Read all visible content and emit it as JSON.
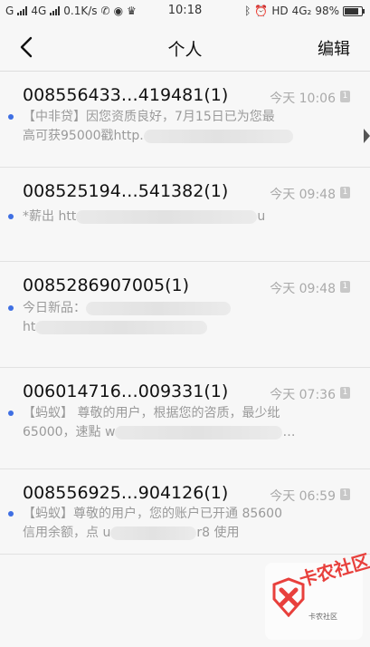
{
  "status_bar": {
    "signal_left": "G",
    "network": "4G",
    "speed": "0.1K/s",
    "time": "10:18",
    "hd": "HD",
    "network_right": "4G₂",
    "battery": "98%"
  },
  "nav": {
    "title": "个人",
    "edit_label": "编辑"
  },
  "messages": [
    {
      "sender": "008556433…419481(1)",
      "time": "今天 10:06",
      "sim": "1",
      "preview_line1": "【中非贷】因您资质良好，7月15日已为您最",
      "preview_line2": "高可获95000戳http."
    },
    {
      "sender": "008525194…541382(1)",
      "time": "今天 09:48",
      "sim": "1",
      "preview_line1": "*薪出  htt",
      "preview_line1_tail": "u"
    },
    {
      "sender": "0085286907005(1)",
      "time": "今天 09:48",
      "sim": "1",
      "preview_line1": "今日新品：",
      "preview_line2": "ht"
    },
    {
      "sender": "006014716…009331(1)",
      "time": "今天 07:36",
      "sim": "1",
      "preview_line1": "【蚂蚁】 尊敬的用户，根据您的咨质，最少纰",
      "preview_line2": "65000，速點 w",
      "preview_line2_tail": "…"
    },
    {
      "sender": "008556925…904126(1)",
      "time": "今天 06:59",
      "sim": "1",
      "preview_line1": "【蚂蚁】尊敬的用户，您的账户已开通 85600",
      "preview_line2": "信用余额，点 u",
      "preview_line2_tail": "r8  使用"
    }
  ],
  "watermark": {
    "name": "卡农社区",
    "sub": "卡农社区"
  },
  "colors": {
    "unread_dot": "#3f6fe3",
    "watermark_red": "#e8403c",
    "background": "#f7f7f7"
  }
}
